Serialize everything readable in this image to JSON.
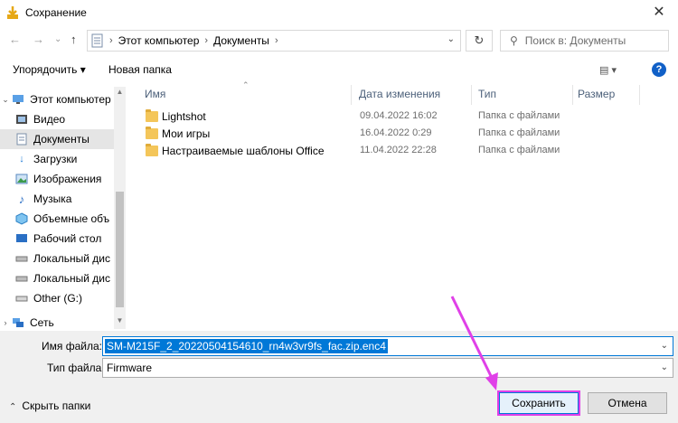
{
  "window": {
    "title": "Сохранение",
    "close_glyph": "✕"
  },
  "nav": {
    "back_glyph": "←",
    "forward_glyph": "→",
    "recent_glyph": "⌄",
    "up_glyph": "↑",
    "breadcrumb": [
      "Этот компьютер",
      "Документы"
    ],
    "crumb_sep": "›",
    "address_dropdown": "⌄",
    "refresh_glyph": "↻",
    "search_placeholder": "Поиск в: Документы"
  },
  "commands": {
    "organize": "Упорядочить ▾",
    "new_folder": "Новая папка",
    "view_glyph": "▤ ▾",
    "help_glyph": "?"
  },
  "sidebar": {
    "items": [
      {
        "label": "Этот компьютер",
        "icon": "computer-icon"
      },
      {
        "label": "Видео",
        "icon": "video-icon"
      },
      {
        "label": "Документы",
        "icon": "documents-icon"
      },
      {
        "label": "Загрузки",
        "icon": "downloads-icon"
      },
      {
        "label": "Изображения",
        "icon": "images-icon"
      },
      {
        "label": "Музыка",
        "icon": "music-icon"
      },
      {
        "label": "Объемные объ",
        "icon": "3d-objects-icon"
      },
      {
        "label": "Рабочий стол",
        "icon": "desktop-icon"
      },
      {
        "label": "Локальный дис",
        "icon": "local-disk-icon"
      },
      {
        "label": "Локальный дис",
        "icon": "local-disk-icon"
      },
      {
        "label": "Other (G:)",
        "icon": "drive-icon"
      },
      {
        "label": "Сеть",
        "icon": "network-icon"
      }
    ]
  },
  "columns": {
    "name": "Имя",
    "date": "Дата изменения",
    "type": "Тип",
    "size": "Размер"
  },
  "files": [
    {
      "name": "Lightshot",
      "date": "09.04.2022 16:02",
      "type": "Папка с файлами"
    },
    {
      "name": "Мои игры",
      "date": "16.04.2022 0:29",
      "type": "Папка с файлами"
    },
    {
      "name": "Настраиваемые шаблоны Office",
      "date": "11.04.2022 22:28",
      "type": "Папка с файлами"
    }
  ],
  "form": {
    "filename_label": "Имя файла:",
    "filename_value": "SM-M215F_2_20220504154610_rn4w3vr9fs_fac.zip.enc4",
    "filetype_label": "Тип файла:",
    "filetype_value": "Firmware",
    "dropdown_glyph": "⌄"
  },
  "footer": {
    "hide_folders": "Скрыть папки",
    "save": "Сохранить",
    "cancel": "Отмена"
  },
  "colors": {
    "accent": "#0078d7",
    "highlight_annotation": "#e040e8"
  }
}
